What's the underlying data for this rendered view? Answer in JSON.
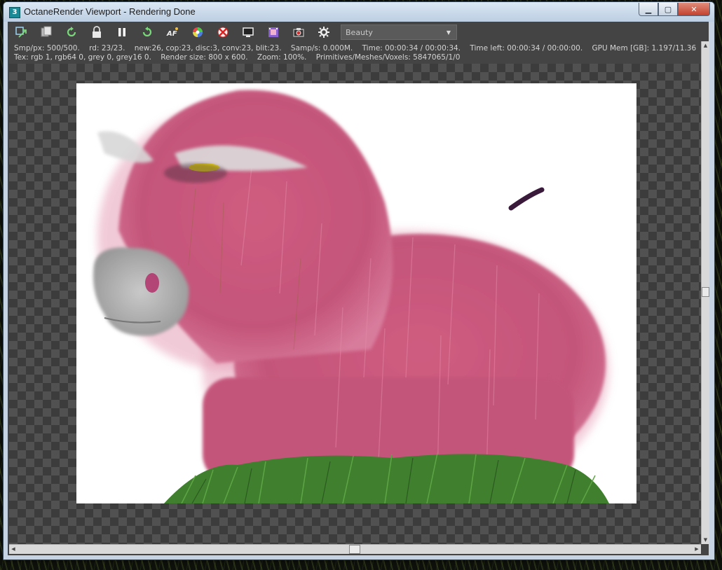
{
  "window": {
    "app_icon_label": "3",
    "title": "OctaneRender Viewport - Rendering Done",
    "minimize_glyph": "▁",
    "maximize_glyph": "▢",
    "close_glyph": "✕"
  },
  "toolbar": {
    "icons": [
      "send-to-scene-icon",
      "copy-icon",
      "refresh-icon",
      "lock-icon",
      "pause-icon",
      "restart-icon",
      "af-icon",
      "color-wheel-icon",
      "region-icon",
      "display-icon",
      "film-icon",
      "camera-icon",
      "settings-icon"
    ],
    "pass_dropdown": {
      "selected": "Beauty",
      "arrow": "▼"
    }
  },
  "stats": {
    "line1": "Smp/px: 500/500.    rd: 23/23.    new:26, cop:23, disc:3, conv:23, blit:23.    Samp/s: 0.000M.    Time: 00:00:34 / 00:00:34.    Time left: 00:00:34 / 00:00:00.    GPU Mem [GB]: 1.197/11.36",
    "line2": "Tex: rgb 1, rgb64 0, grey 0, grey16 0.    Render size: 800 x 600.    Zoom: 100%.    Primitives/Meshes/Voxels: 5847065/1/0"
  },
  "scrollbars": {
    "up_arrow": "▲",
    "down_arrow": "▼",
    "left_arrow": "◀",
    "right_arrow": "▶"
  },
  "colors": {
    "fur": "#d45a7e",
    "grass": "#3f7f2e",
    "toolbar_bg": "#444444"
  }
}
